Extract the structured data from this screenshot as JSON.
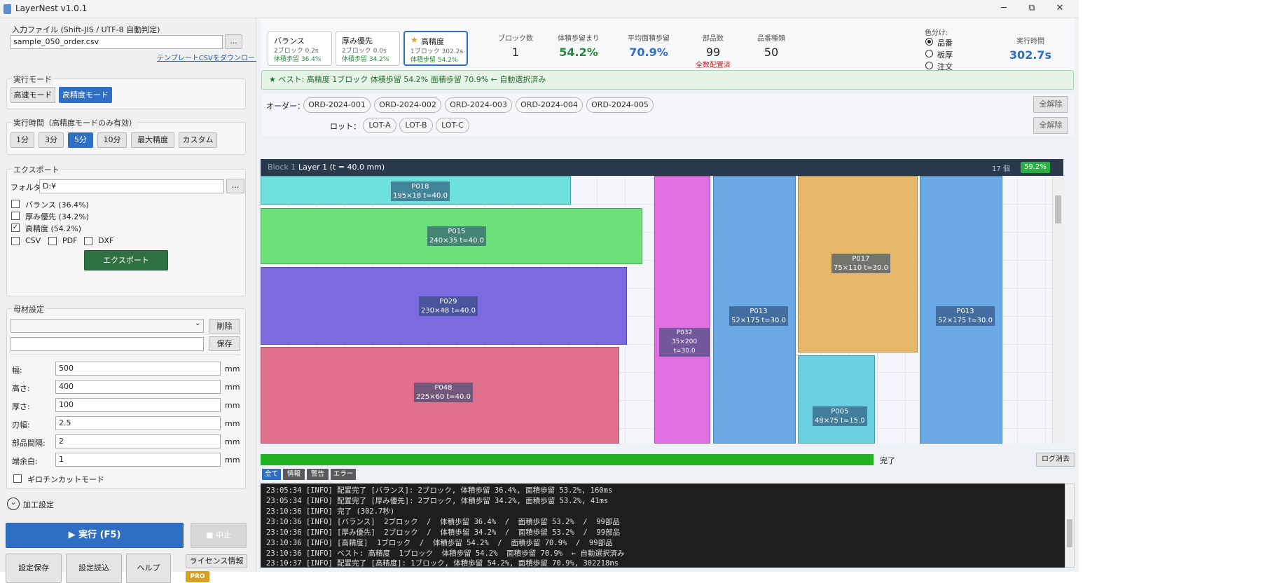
{
  "window": {
    "title": "LayerNest v1.0.1",
    "min": "─",
    "max": "⧉",
    "close": "✕"
  },
  "input": {
    "label": "入力ファイル (Shift-JIS / UTF-8 自動判定)",
    "file": "sample_050_order.csv",
    "browse": "...",
    "template_link": "テンプレートCSVをダウンロード"
  },
  "mode": {
    "label": "実行モード",
    "fast": "高速モード",
    "precise": "高精度モード"
  },
  "time": {
    "label": "実行時間（高精度モードのみ有効）",
    "options": [
      "1分",
      "3分",
      "5分",
      "10分",
      "最大精度",
      "カスタム"
    ],
    "selected": "5分"
  },
  "export": {
    "label": "エクスポート",
    "folder_label": "フォルダ:",
    "folder": "D:¥",
    "browse": "...",
    "options": [
      {
        "label": "バランス (36.4%)",
        "checked": false
      },
      {
        "label": "厚み優先 (34.2%)",
        "checked": false
      },
      {
        "label": "高精度 (54.2%)",
        "checked": true
      }
    ],
    "formats": [
      {
        "label": "CSV",
        "checked": false
      },
      {
        "label": "PDF",
        "checked": false
      },
      {
        "label": "DXF",
        "checked": false
      }
    ],
    "button": "エクスポート",
    "check_mark": "✓"
  },
  "material": {
    "label": "母材設定",
    "select": "",
    "delete": "削除",
    "name": "",
    "save": "保存",
    "fields": [
      {
        "label": "幅:",
        "value": "500",
        "unit": "mm"
      },
      {
        "label": "高さ:",
        "value": "400",
        "unit": "mm"
      },
      {
        "label": "厚さ:",
        "value": "100",
        "unit": "mm"
      },
      {
        "label": "刃幅:",
        "value": "2.5",
        "unit": "mm"
      },
      {
        "label": "部品間隔:",
        "value": "2",
        "unit": "mm"
      },
      {
        "label": "端余白:",
        "value": "1",
        "unit": "mm"
      }
    ],
    "guillotine": "ギロチンカットモード"
  },
  "processing": {
    "label": "加工設定",
    "icon": "⌄"
  },
  "actions": {
    "run": "▶ 実行 (F5)",
    "stop": "■ 中止",
    "save_settings": "設定保存",
    "load_settings": "設定読込",
    "help": "ヘルプ",
    "license": "ライセンス情報",
    "pro": "PRO"
  },
  "results": [
    {
      "title": "バランス",
      "sub": "2ブロック  0.2s",
      "yield": "体積歩留 36.4%"
    },
    {
      "title": "厚み優先",
      "sub": "2ブロック  0.0s",
      "yield": "体積歩留 34.2%"
    },
    {
      "title": "高精度",
      "star": "★",
      "sub": "1ブロック  302.2s",
      "yield": "体積歩留 54.2%"
    }
  ],
  "stats": [
    {
      "label": "ブロック数",
      "value": "1",
      "note": ""
    },
    {
      "label": "体積歩留まり",
      "value": "54.2%",
      "note": ""
    },
    {
      "label": "平均面積歩留",
      "value": "70.9%",
      "note": ""
    },
    {
      "label": "部品数",
      "value": "99",
      "note": "全数配置済"
    },
    {
      "label": "品番種類",
      "value": "50",
      "note": ""
    }
  ],
  "colorby": {
    "label": "色分け:",
    "options": [
      "品番",
      "板厚",
      "注文"
    ],
    "selected": "品番"
  },
  "runtime": {
    "label": "実行時間",
    "value": "302.7s"
  },
  "best_banner": "★ ベスト: 高精度  1ブロック  体積歩留 54.2%  面積歩留 70.9%  ← 自動選択済み",
  "orders": {
    "label": "オーダー：",
    "items": [
      "ORD-2024-001",
      "ORD-2024-002",
      "ORD-2024-003",
      "ORD-2024-004",
      "ORD-2024-005"
    ],
    "clear": "全解除"
  },
  "lots": {
    "label": "ロット：",
    "items": [
      "LOT-A",
      "LOT-B",
      "LOT-C"
    ],
    "clear": "全解除"
  },
  "layout": {
    "block": "Block 1",
    "layer": "Layer 1  (t = 40.0 mm)",
    "count": "17 個",
    "percent": "59.2%",
    "pieces": [
      {
        "id": "P018",
        "size": "195×18  t=40.0",
        "color": "#6ee0dc"
      },
      {
        "id": "P015",
        "size": "240×35  t=40.0",
        "color": "#6ee07a"
      },
      {
        "id": "P029",
        "size": "230×48  t=40.0",
        "color": "#7c6ae0"
      },
      {
        "id": "P048",
        "size": "225×60  t=40.0",
        "color": "#e0708e"
      },
      {
        "id": "P032",
        "size": "35×200  t=30.0",
        "color": "#e070e0"
      },
      {
        "id": "P013",
        "size": "52×175  t=30.0",
        "color": "#6aa8e6"
      },
      {
        "id": "P017",
        "size": "75×110  t=30.0",
        "color": "#e6b86a"
      },
      {
        "id": "P005",
        "size": "48×75  t=15.0",
        "color": "#6ad0e0"
      },
      {
        "id": "P013",
        "size": "52×175  t=30.0",
        "color": "#6aa8e6"
      }
    ]
  },
  "progress": {
    "value": 1.0,
    "label": "完了",
    "clear": "ログ消去"
  },
  "filters": [
    "全て",
    "情報",
    "警告",
    "エラー"
  ],
  "log": [
    "23:05:34 [INFO] 配置完了 [バランス]: 2ブロック, 体積歩留 36.4%, 面積歩留 53.2%, 160ms",
    "23:05:34 [INFO] 配置完了 [厚み優先]: 2ブロック, 体積歩留 34.2%, 面積歩留 53.2%, 41ms",
    "23:10:36 [INFO] 完了 (302.7秒)",
    "23:10:36 [INFO] [バランス]  2ブロック  /  体積歩留 36.4%  /  面積歩留 53.2%  /  99部品",
    "23:10:36 [INFO] [厚み優先]  2ブロック  /  体積歩留 34.2%  /  面積歩留 53.2%  /  99部品",
    "23:10:36 [INFO] [高精度]  1ブロック  /  体積歩留 54.2%  /  面積歩留 70.9%  /  99部品",
    "23:10:36 [INFO] ベスト: 高精度  1ブロック  体積歩留 54.2%  面積歩留 70.9%  ← 自動選択済み",
    "23:10:37 [INFO] 配置完了 [高精度]: 1ブロック, 体積歩留 54.2%, 面積歩留 70.9%, 302218ms"
  ],
  "colors": {
    "accent": "#2f6fc3",
    "success": "#2a8a3a",
    "progress": "#22b322",
    "warning": "#d02020",
    "runtime": "#2f6fc3"
  }
}
